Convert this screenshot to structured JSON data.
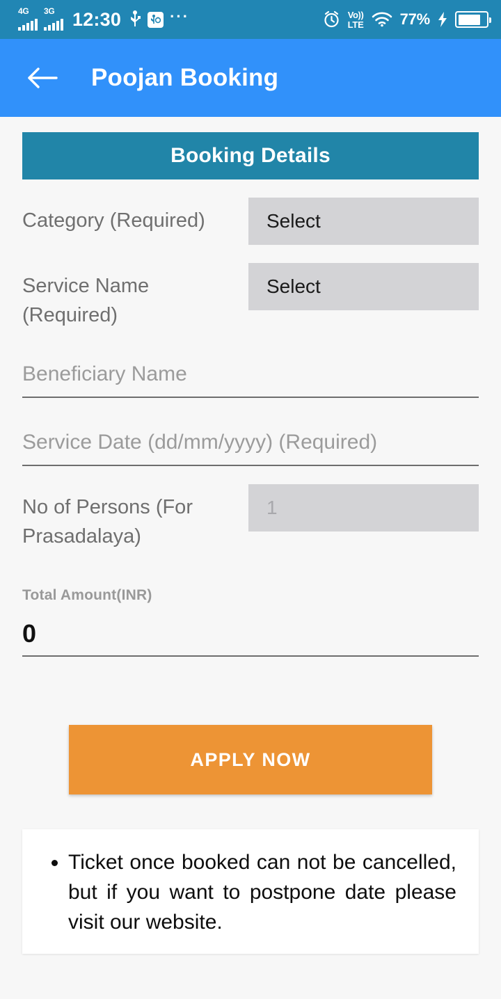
{
  "status_bar": {
    "network_primary": "4G",
    "network_secondary": "3G",
    "time": "12:30",
    "usb_icon": "usb-icon",
    "usb_debug_icon": "usb-debugging-icon",
    "overflow": "···",
    "alarm_icon": "alarm-clock-icon",
    "volte_top": "Vo))",
    "volte_bottom": "LTE",
    "wifi_icon": "wifi-icon",
    "battery_percent": "77%",
    "charging_icon": "charging-bolt-icon",
    "background_color": "#2186b4"
  },
  "app_bar": {
    "back_icon": "back-arrow-icon",
    "title": "Poojan Booking",
    "background_color": "#3191fa"
  },
  "section": {
    "title": "Booking Details",
    "background_color": "#2185a8"
  },
  "form": {
    "category": {
      "label": "Category (Required)",
      "value": "Select"
    },
    "service_name": {
      "label": "Service Name (Required)",
      "value": "Select"
    },
    "beneficiary_name": {
      "placeholder": "Beneficiary Name",
      "value": ""
    },
    "service_date": {
      "placeholder": "Service Date (dd/mm/yyyy) (Required)",
      "value": ""
    },
    "no_of_persons": {
      "label": "No of Persons (For Prasadalaya)",
      "placeholder": "1",
      "value": ""
    },
    "total_amount": {
      "label": "Total Amount(INR)",
      "value": "0"
    }
  },
  "actions": {
    "apply_label": "APPLY NOW",
    "apply_color": "#ed9435"
  },
  "notes": {
    "items": [
      "Ticket once booked can not be cancelled, but if you want to postpone date please visit our website."
    ]
  }
}
